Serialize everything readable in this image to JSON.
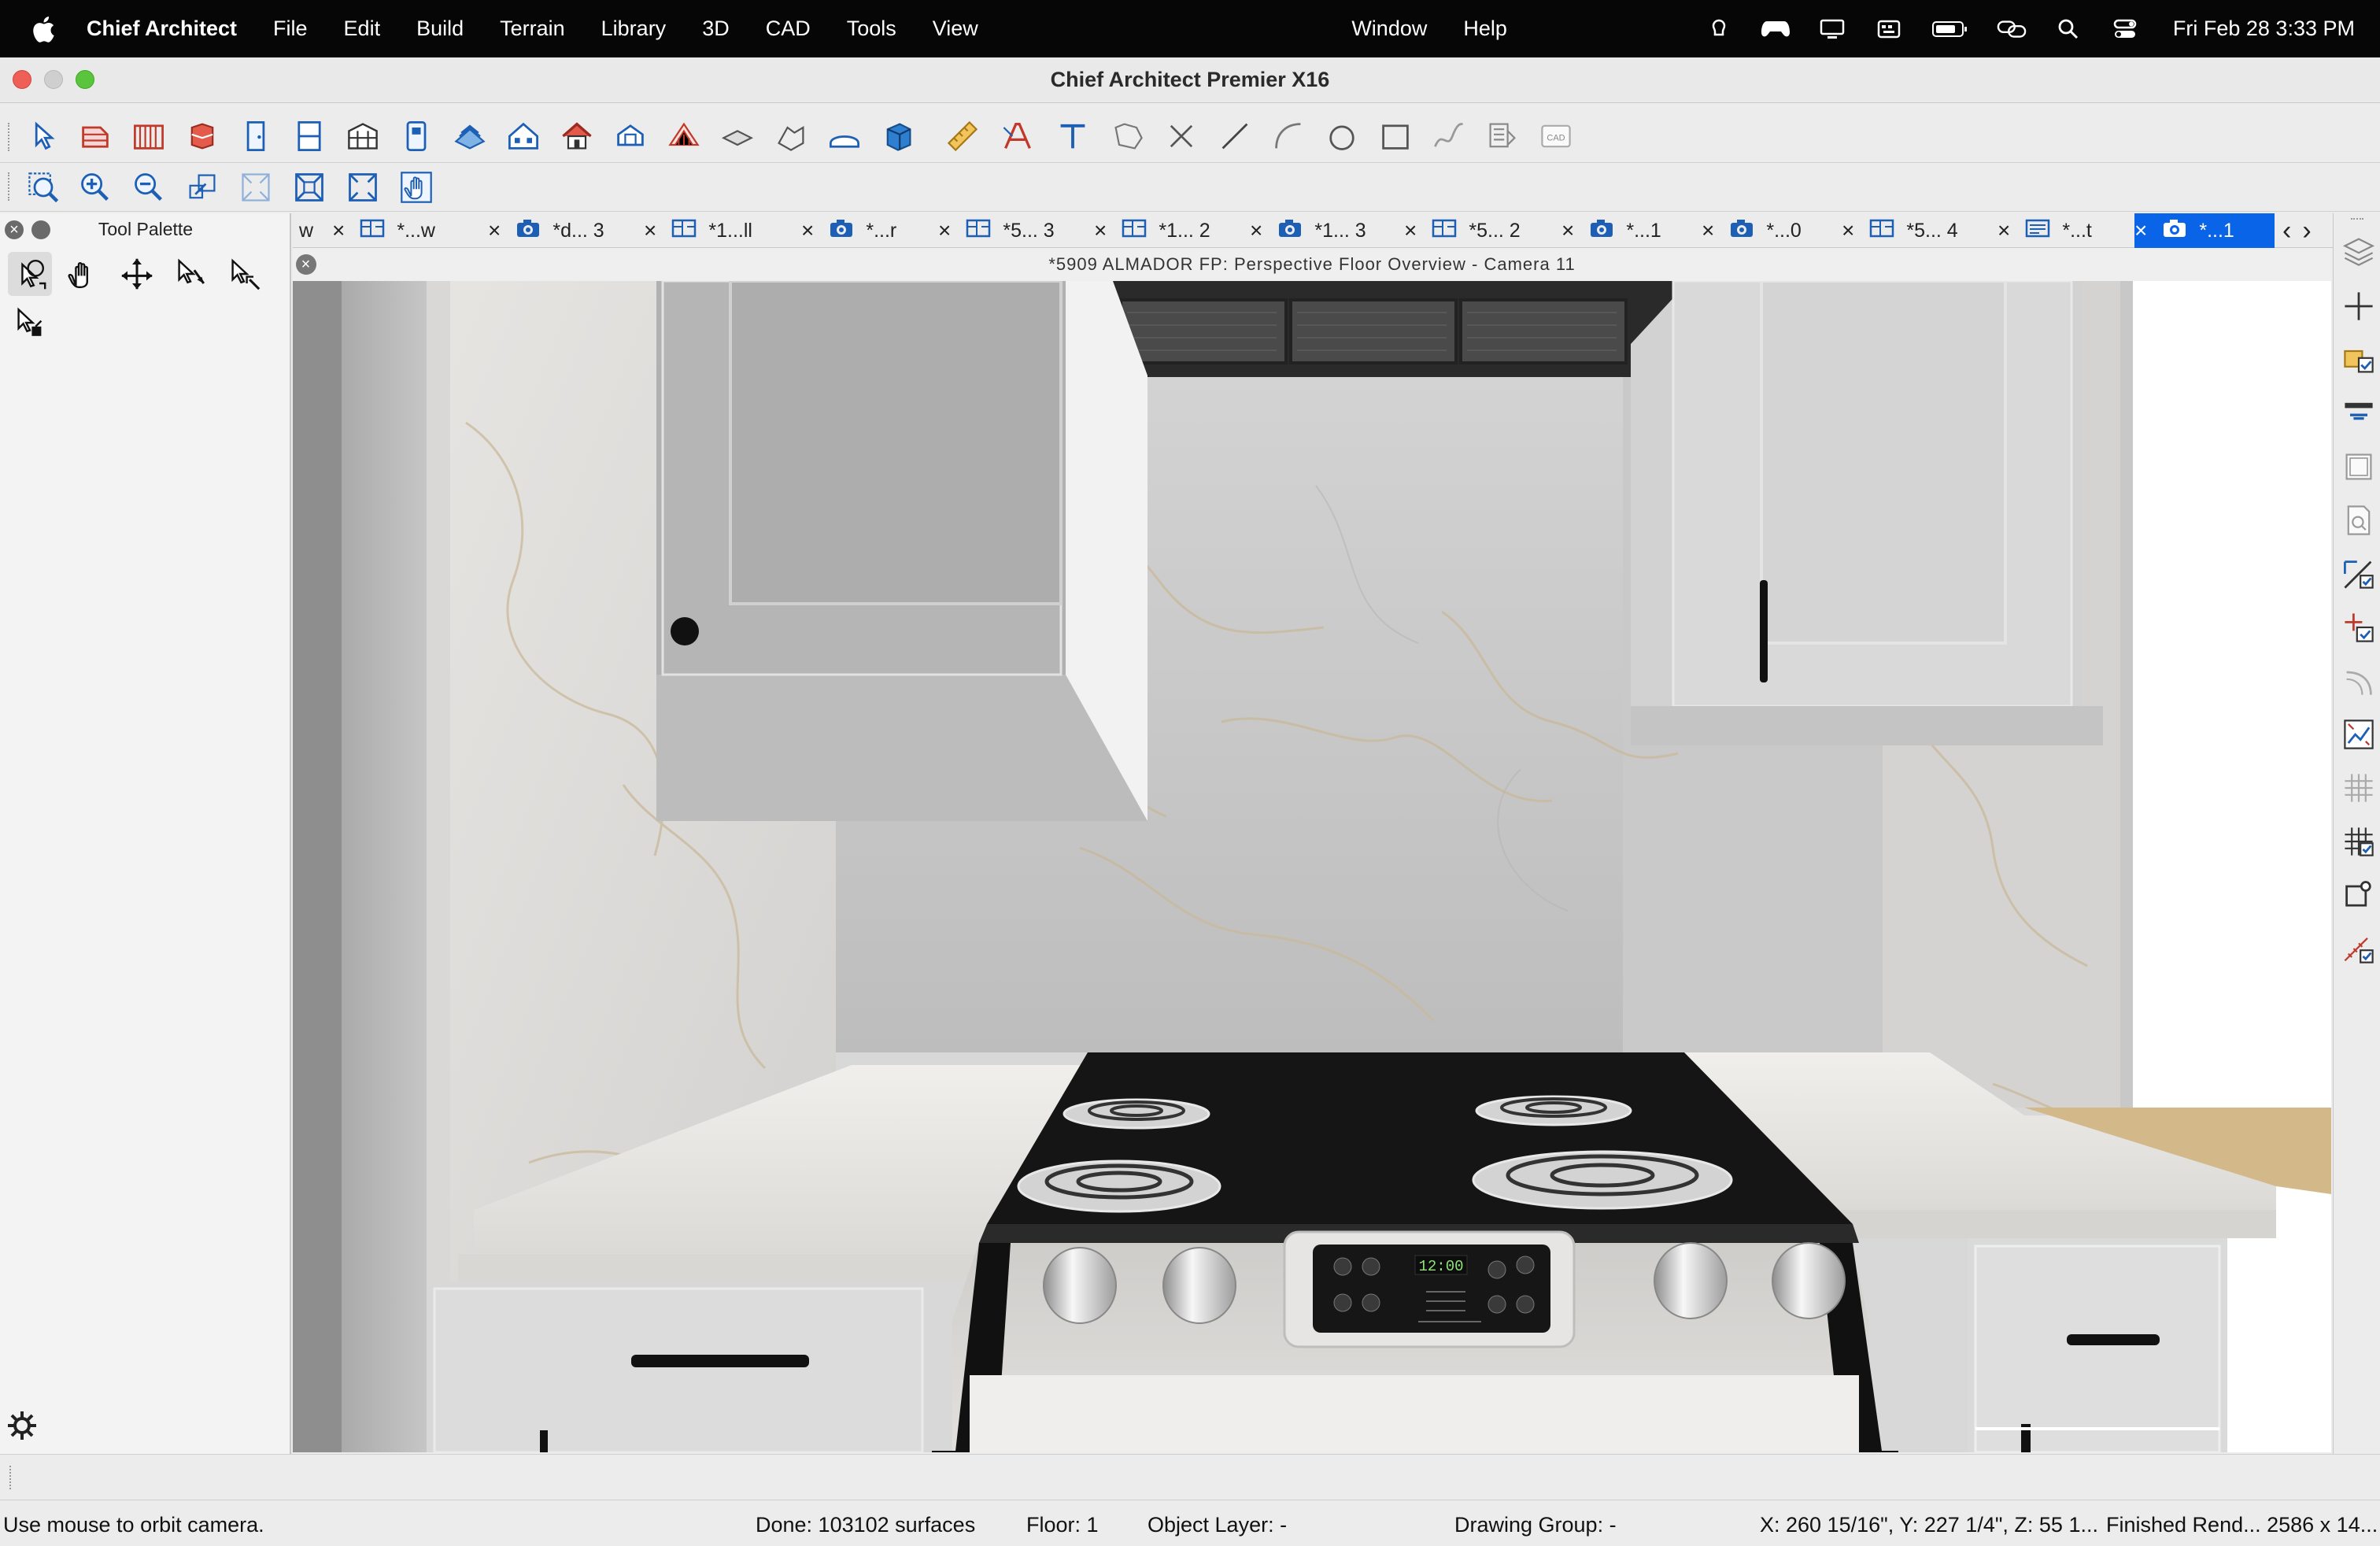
{
  "menubar": {
    "app_name": "Chief Architect",
    "items": [
      "File",
      "Edit",
      "Build",
      "Terrain",
      "Library",
      "3D",
      "CAD",
      "Tools",
      "View"
    ],
    "right_items": [
      "Window",
      "Help"
    ],
    "status_icons": [
      "command-key-icon",
      "gamepad-icon",
      "display-icon",
      "keyboard-icon",
      "battery-icon",
      "link-icon",
      "search-icon",
      "control-center-icon"
    ],
    "clock": "Fri Feb 28  3:33 PM"
  },
  "window": {
    "title": "Chief Architect Premier X16",
    "traffic_colors": [
      "#ee5f57",
      "#c9c9c9",
      "#5ac43c"
    ]
  },
  "toolbar1_icons": [
    "select-objects-icon",
    "wall-tools-icon",
    "railing-icon",
    "cabinet-icon",
    "door-icon",
    "window-icon",
    "stairs-icon",
    "room-icon",
    "roof-icon",
    "house-icon",
    "gable-icon",
    "dormer-icon",
    "framing-icon",
    "floor-icon",
    "shape-icon",
    "arch-icon",
    "box-icon",
    "dimension-icon",
    "text-style-icon",
    "text-icon",
    "cad-region-icon",
    "delete-x-icon",
    "line-icon",
    "arc-icon",
    "circle-icon",
    "rectangle-icon",
    "spline-icon",
    "layer-icon",
    "cad-block-icon"
  ],
  "toolbar2_icons": [
    "zoom-window-icon",
    "zoom-in-icon",
    "zoom-out-icon",
    "undo-zoom-icon",
    "fill-window-icon",
    "fill-building-icon",
    "fill-all-icon",
    "pan-hand-icon"
  ],
  "tabs": [
    {
      "label": "w",
      "icon": ""
    },
    {
      "label": "*...w",
      "icon": "plan-icon"
    },
    {
      "label": "*d... 3",
      "icon": "camera-icon"
    },
    {
      "label": "*1...ll",
      "icon": "plan-icon"
    },
    {
      "label": "*...r",
      "icon": "camera-icon"
    },
    {
      "label": "*5... 3",
      "icon": "plan-icon"
    },
    {
      "label": "*1... 2",
      "icon": "plan-icon"
    },
    {
      "label": "*1... 3",
      "icon": "camera-icon"
    },
    {
      "label": "*5... 2",
      "icon": "plan-icon"
    },
    {
      "label": "*...1",
      "icon": "camera-icon"
    },
    {
      "label": "*...0",
      "icon": "camera-icon"
    },
    {
      "label": "*5... 4",
      "icon": "plan-icon"
    },
    {
      "label": "*...t",
      "icon": "layout-icon"
    },
    {
      "label": "*...1",
      "icon": "camera-icon"
    }
  ],
  "tab_nav": {
    "prev": "‹",
    "next": "›"
  },
  "palette": {
    "title": "Tool Palette",
    "tools": [
      "orbit-camera-icon",
      "pan-hand-icon",
      "move-arrows-icon",
      "tilt-camera-icon",
      "zoom-camera-icon",
      "walkthrough-icon"
    ]
  },
  "view": {
    "title": "*5909 ALMADOR FP: Perspective Floor Overview - Camera 11",
    "range_display": "12:00"
  },
  "right_toolbar_icons": [
    "layers-icon",
    "add-icon",
    "material-check-icon",
    "wall-check-icon",
    "frame-icon",
    "page-search-icon",
    "dimension-check-icon",
    "list-check-icon",
    "curve-icon",
    "chart-check-icon",
    "grid-icon",
    "grid-check-icon",
    "node-icon",
    "ruler-check-icon"
  ],
  "status": {
    "hint": "Use mouse to orbit camera.",
    "done": "Done:  103102 surfaces",
    "floor": "Floor: 1",
    "object_layer": "Object Layer: -",
    "drawing_group": "Drawing Group: -",
    "coords": "X: 260 15/16\", Y: 227 1/4\", Z: 55 1...",
    "render": "Finished Rend...  2586 x 14..."
  }
}
